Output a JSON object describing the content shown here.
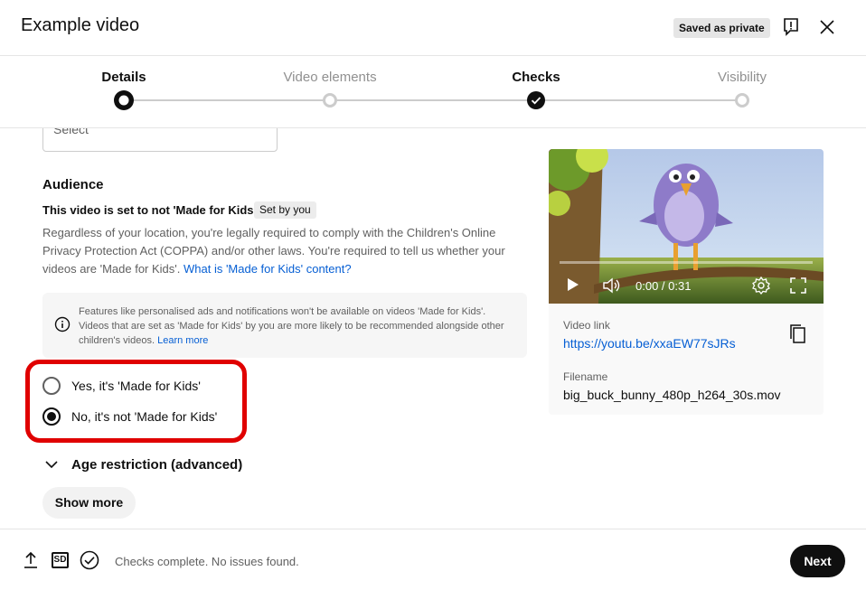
{
  "header": {
    "title": "Example video",
    "saved_badge": "Saved as private"
  },
  "stepper": {
    "steps": [
      {
        "label": "Details",
        "state": "current"
      },
      {
        "label": "Video elements",
        "state": "pending"
      },
      {
        "label": "Checks",
        "state": "done"
      },
      {
        "label": "Visibility",
        "state": "pending"
      }
    ]
  },
  "form": {
    "select_placeholder": "Select",
    "audience": {
      "heading": "Audience",
      "status": "This video is set to not 'Made for Kids'",
      "set_by": "Set by you",
      "description": "Regardless of your location, you're legally required to comply with the Children's Online Privacy Protection Act (COPPA) and/or other laws. You're required to tell us whether your videos are 'Made for Kids'. ",
      "description_link": "What is 'Made for Kids' content?",
      "info_text": "Features like personalised ads and notifications won't be available on videos 'Made for Kids'. Videos that are set as 'Made for Kids' by you are more likely to be recommended alongside other children's videos. ",
      "info_link": "Learn more",
      "options": [
        {
          "label": "Yes, it's 'Made for Kids'",
          "checked": false
        },
        {
          "label": "No, it's not 'Made for Kids'",
          "checked": true
        }
      ]
    },
    "age_restriction": "Age restriction (advanced)",
    "show_more": "Show more"
  },
  "video": {
    "time": "0:00 / 0:31",
    "link_label": "Video link",
    "link": "https://youtu.be/xxaEW77sJRs",
    "filename_label": "Filename",
    "filename": "big_buck_bunny_480p_h264_30s.mov"
  },
  "footer": {
    "status": "Checks complete. No issues found.",
    "next": "Next",
    "sd_badge": "SD"
  },
  "colors": {
    "accent_link": "#065fd4",
    "highlight_frame": "#e00000",
    "primary_button": "#0f0f0f"
  }
}
